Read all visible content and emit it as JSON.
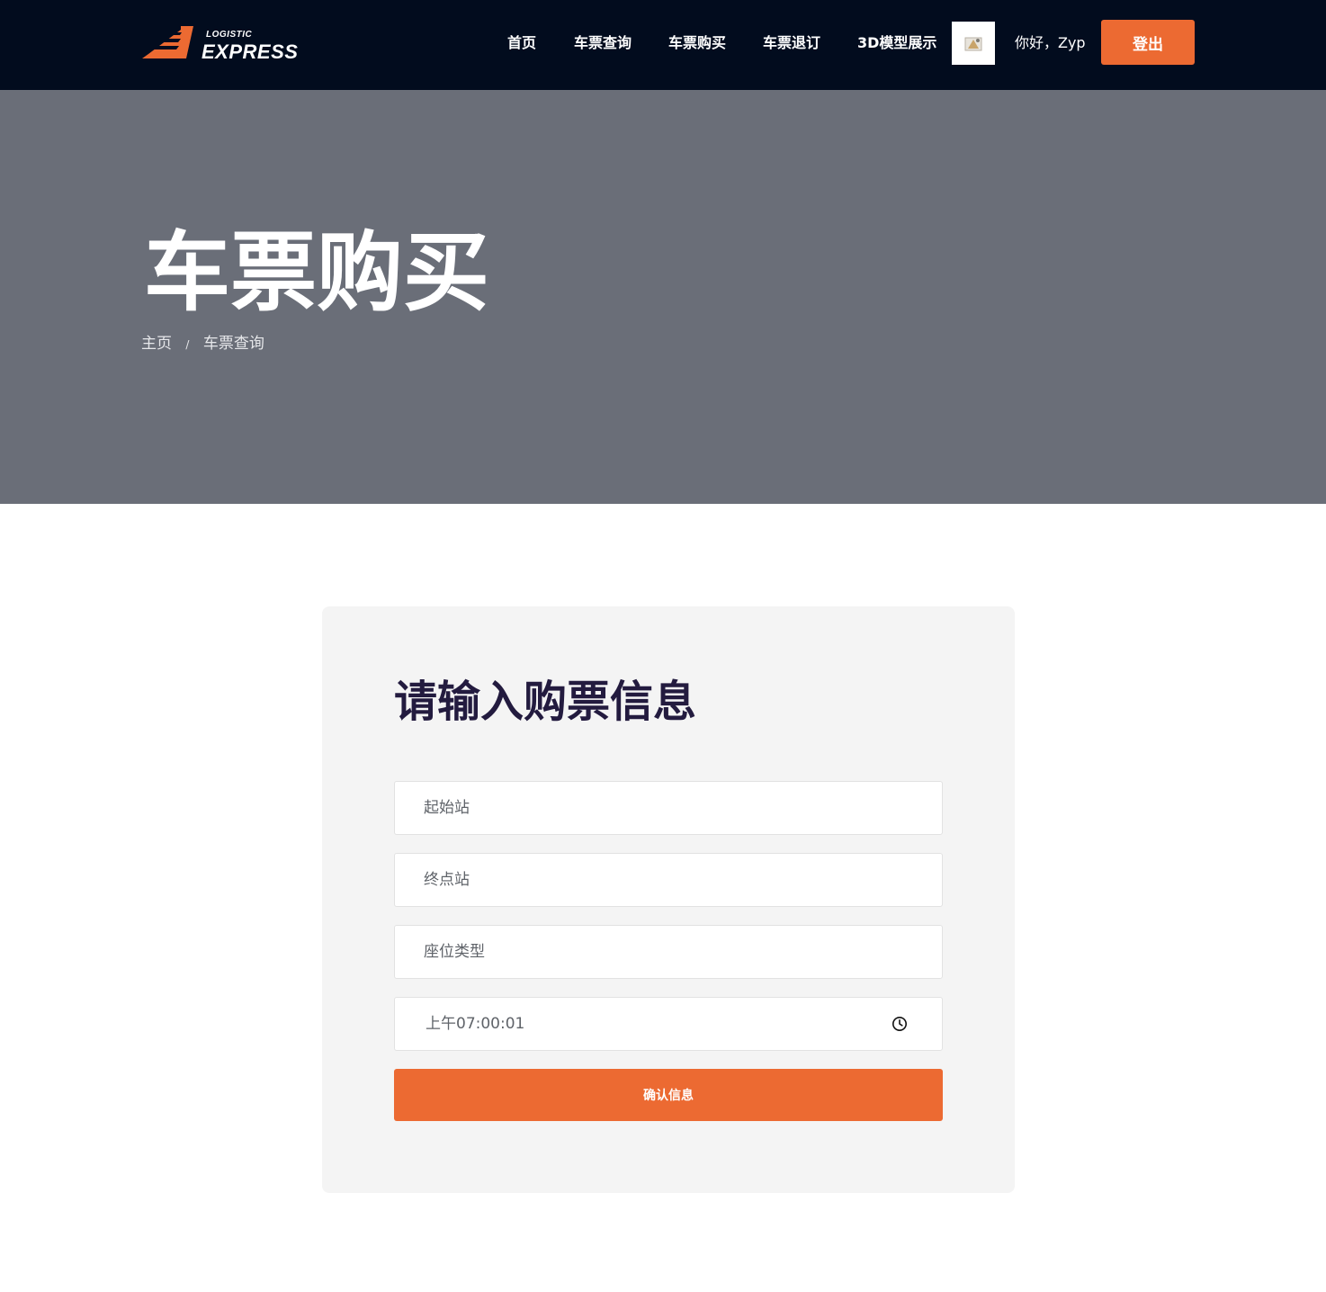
{
  "header": {
    "logo": {
      "small_text": "LOGISTIC",
      "big_text": "EXPRESS",
      "mark_color": "#ec6a32"
    },
    "nav": [
      {
        "label": "首页"
      },
      {
        "label": "车票查询"
      },
      {
        "label": "车票购买"
      },
      {
        "label": "车票退订"
      },
      {
        "label": "3D模型展示"
      }
    ],
    "greeting": "你好，Zyp",
    "logout_label": "登出",
    "background_color": "#020c1e",
    "accent_color": "#ec6a32"
  },
  "hero": {
    "title": "车票购买",
    "breadcrumb": {
      "home": "主页",
      "separator": "/",
      "current": "车票查询"
    },
    "background_color": "#6a6e78"
  },
  "form": {
    "title": "请输入购票信息",
    "start_station": {
      "placeholder": "起始站",
      "value": ""
    },
    "end_station": {
      "placeholder": "终点站",
      "value": ""
    },
    "seat_type": {
      "placeholder": "座位类型",
      "value": ""
    },
    "time": {
      "value": "上午07:00:01",
      "icon": "clock-icon"
    },
    "submit_label": "确认信息"
  }
}
